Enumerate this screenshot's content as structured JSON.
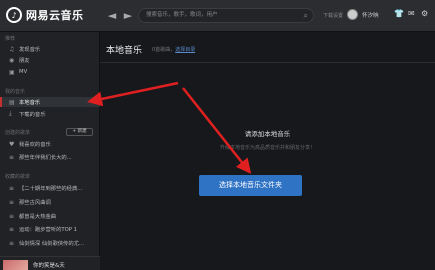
{
  "app": {
    "logo_text": "网易云音乐",
    "logo_icon": "netease-cloud-music-logo"
  },
  "header": {
    "back_icon": "◄",
    "forward_icon": "►",
    "search_placeholder": "搜索音乐，歌手，歌词，用户",
    "quality_text": "下载设置",
    "username": "怀汐晌",
    "icons": [
      "avatar-icon",
      "shirt-icon",
      "mail-icon",
      "gear-icon"
    ]
  },
  "sidebar": {
    "section_recommend": "推荐",
    "recommend_items": [
      {
        "icon": "♫",
        "label": "发现音乐"
      },
      {
        "icon": "◉",
        "label": "朋友"
      },
      {
        "icon": "▣",
        "label": "MV"
      }
    ],
    "section_my_music": "我的音乐",
    "my_music_items": [
      {
        "icon": "▤",
        "label": "本地音乐"
      },
      {
        "icon": "⤓",
        "label": "下载的音乐"
      }
    ],
    "section_created": "创建的歌单",
    "new_button": "+ 新建",
    "created_items": [
      {
        "icon": "♥",
        "label": "我喜欢的音乐"
      },
      {
        "icon": "≡",
        "label": "那些年伴我们长大的..."
      }
    ],
    "section_collected": "收藏的歌单",
    "collected_items": [
      {
        "icon": "≡",
        "label": "【二十期年到那些的经典..."
      },
      {
        "icon": "≡",
        "label": "那些古风曲调"
      },
      {
        "icon": "≡",
        "label": "都曾是大热金曲"
      },
      {
        "icon": "≡",
        "label": "运动：跑步营听的TOP 1"
      },
      {
        "icon": "≡",
        "label": "仙剑情深 仙剑歌侠传的尤..."
      }
    ],
    "now_playing": "你的笑是&天"
  },
  "main": {
    "title": "本地音乐",
    "sub_count": "0首歌曲，",
    "sub_link": "选择目录",
    "prompt": "请添加本地音乐",
    "hint": "升级本地音乐为高品质音乐并和朋友分享！",
    "choose_button": "选择本地音乐文件夹"
  },
  "colors": {
    "accent": "#c62f2f",
    "button": "#2f73c4",
    "arrow": "#e02020"
  }
}
